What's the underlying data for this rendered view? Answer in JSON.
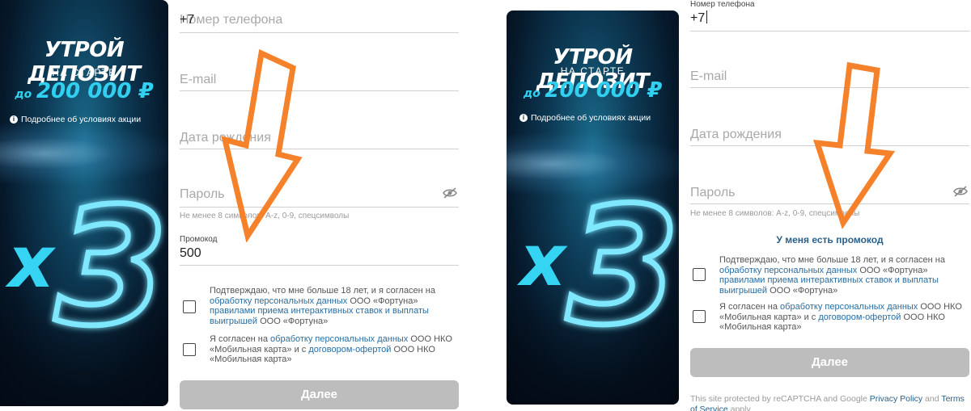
{
  "banner": {
    "title": "УТРОЙ ДЕПОЗИТ",
    "subtitle": "НА СТАРТЕ",
    "amount_prefix": "до",
    "amount": "200 000 ₽",
    "note": "Подробнее об условиях акции",
    "multiplier": "x3"
  },
  "left": {
    "phone_value": "+7",
    "phone_placeholder": "Номер телефона",
    "email_placeholder": "E-mail",
    "birthdate_placeholder": "Дата рождения",
    "password_placeholder": "Пароль",
    "password_hint": "Не менее 8 символов: A-z, 0-9, спецсимволы",
    "promo_label": "Промокод",
    "promo_value": "500",
    "consent1": {
      "t1": "Подтверждаю, что мне больше 18 лет, и я согласен на ",
      "l1": "обработку персональных данных",
      "t2": " ООО «Фортуна» ",
      "l2": "правилами приема интерактивных ставок и выплаты выигрышей",
      "t3": " ООО «Фортуна»"
    },
    "consent2": {
      "t1": "Я согласен на ",
      "l1": "обработку персональных данных",
      "t2": " ООО НКО «Мобильная карта» и с ",
      "l2": "договором-офертой",
      "t3": " ООО НКО «Мобильная карта»"
    },
    "submit_label": "Далее"
  },
  "right": {
    "phone_label": "Номер телефона",
    "phone_value": "+7",
    "email_placeholder": "E-mail",
    "birthdate_placeholder": "Дата рождения",
    "password_placeholder": "Пароль",
    "password_hint": "Не менее 8 символов: A-z, 0-9, спецсимволы",
    "promo_link": "У меня есть промокод",
    "consent1": {
      "t1": "Подтверждаю, что мне больше 18 лет, и я согласен на ",
      "l1": "обработку персональных данных",
      "t2": " ООО «Фортуна» ",
      "l2": "правилами приема интерактивных ставок и выплаты выигрышей",
      "t3": " ООО «Фортуна»"
    },
    "consent2": {
      "t1": "Я согласен на ",
      "l1": "обработку персональных данных",
      "t2": " ООО НКО «Мобильная карта» и с ",
      "l2": "договором-офертой",
      "t3": " ООО НКО «Мобильная карта»"
    },
    "submit_label": "Далее",
    "recaptcha": {
      "t1": "This site protected by reCAPTCHA and Google ",
      "l1": "Privacy Policy",
      "t2": " and ",
      "l2": "Terms of Service",
      "t3": " apply"
    }
  },
  "colors": {
    "accent_cyan": "#31d0f0",
    "link": "#2a6da0",
    "button_disabled": "#bdbdbd",
    "annotation_arrow": "#f5822a"
  }
}
